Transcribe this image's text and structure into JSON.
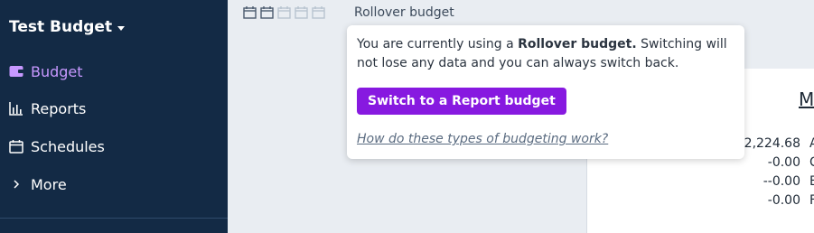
{
  "sidebar": {
    "budget_name": "Test Budget",
    "items": [
      {
        "label": "Budget",
        "icon": "wallet-icon",
        "active": true
      },
      {
        "label": "Reports",
        "icon": "bar-chart-icon",
        "active": false
      },
      {
        "label": "Schedules",
        "icon": "calendar-icon",
        "active": false
      },
      {
        "label": "More",
        "icon": "chevron-right-icon",
        "active": false
      }
    ]
  },
  "header": {
    "budget_type_label": "Rollover budget"
  },
  "popover": {
    "text_prefix": "You are currently using a ",
    "text_bold": "Rollover budget.",
    "text_suffix": " Switching will not lose any data and you can always switch back.",
    "button_label": "Switch to a Report budget",
    "help_link": "How do these types of budgeting work?"
  },
  "panel": {
    "month_title_partial": "M",
    "rows": [
      {
        "value": "2,224.68",
        "label": "A"
      },
      {
        "value": "-0.00",
        "label": "C"
      },
      {
        "value": "--0.00",
        "label": "E"
      },
      {
        "value": "-0.00",
        "label": "F"
      }
    ]
  },
  "colors": {
    "sidebar_bg": "#132a45",
    "accent_purple": "#8719e0",
    "active_nav": "#c798ff"
  }
}
